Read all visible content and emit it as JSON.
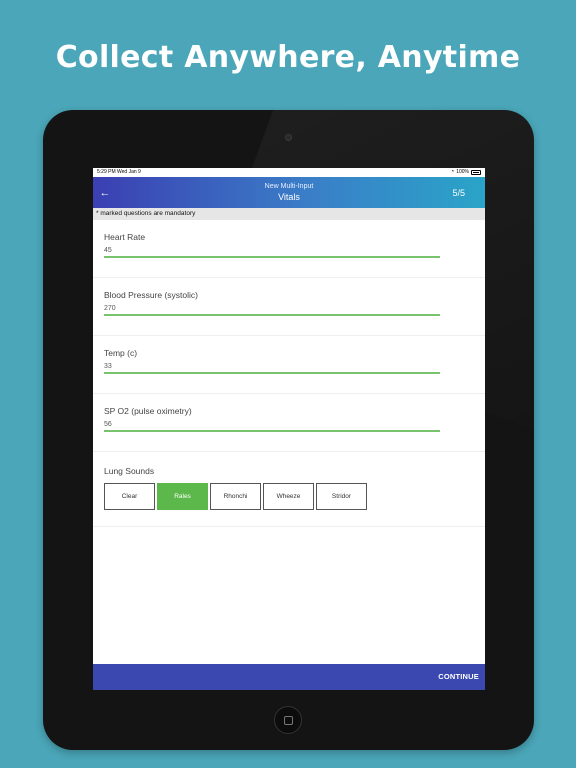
{
  "headline": "Collect Anywhere, Anytime",
  "status_bar": {
    "time_date": "5:29 PM   Wed Jan 9",
    "battery": "100%"
  },
  "app_bar": {
    "subtitle": "New Multi-Input",
    "title": "Vitals",
    "page_indicator": "5/5",
    "back_icon": "arrow-left-icon"
  },
  "mandatory_note": "* marked questions are mandatory",
  "fields": [
    {
      "label": "Heart Rate",
      "value": "45"
    },
    {
      "label": "Blood Pressure (systolic)",
      "value": "270"
    },
    {
      "label": "Temp (c)",
      "value": "33"
    },
    {
      "label": "SP O2 (pulse oximetry)",
      "value": "56"
    }
  ],
  "lung_sounds": {
    "label": "Lung Sounds",
    "options": [
      "Clear",
      "Rales",
      "Rhonchi",
      "Wheeze",
      "Stridor"
    ],
    "selected": "Rales"
  },
  "continue_label": "CONTINUE",
  "colors": {
    "background": "#4aa6b8",
    "accent_green": "#5cb84a",
    "continue_bar": "#3a48b0"
  }
}
